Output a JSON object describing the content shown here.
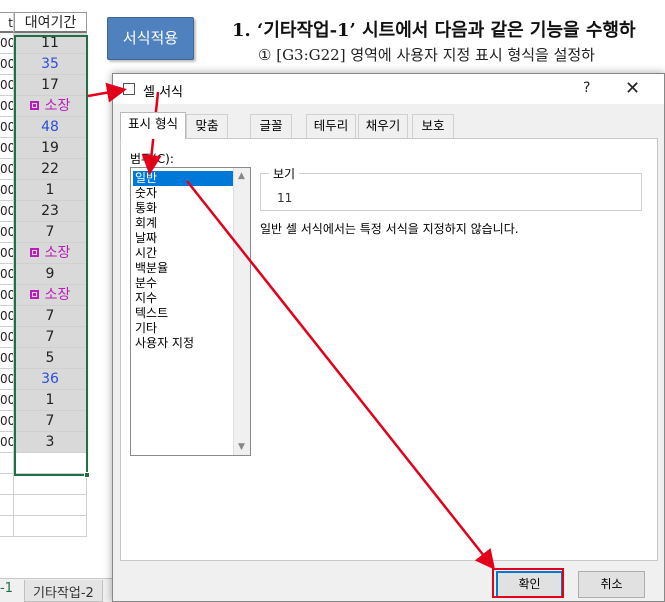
{
  "sheet": {
    "left_col": [
      "t",
      "00",
      "00",
      "00",
      "00",
      "00",
      "00",
      "00",
      "00",
      "00",
      "00",
      "00",
      "00",
      "00",
      "00",
      "00",
      "00",
      "00",
      "00",
      "00",
      "00"
    ],
    "header": "대여기간",
    "rows": [
      {
        "text": "11",
        "style": "plain"
      },
      {
        "text": "35",
        "style": "blue"
      },
      {
        "text": "17",
        "style": "plain"
      },
      {
        "text": "소장",
        "style": "purple"
      },
      {
        "text": "48",
        "style": "blue"
      },
      {
        "text": "19",
        "style": "plain"
      },
      {
        "text": "22",
        "style": "plain"
      },
      {
        "text": "1",
        "style": "plain"
      },
      {
        "text": "23",
        "style": "plain"
      },
      {
        "text": "7",
        "style": "plain"
      },
      {
        "text": "소장",
        "style": "purple"
      },
      {
        "text": "9",
        "style": "plain"
      },
      {
        "text": "소장",
        "style": "purple"
      },
      {
        "text": "7",
        "style": "plain"
      },
      {
        "text": "7",
        "style": "plain"
      },
      {
        "text": "5",
        "style": "plain"
      },
      {
        "text": "36",
        "style": "blue"
      },
      {
        "text": "1",
        "style": "plain"
      },
      {
        "text": "7",
        "style": "plain"
      },
      {
        "text": "3",
        "style": "plain"
      }
    ],
    "tabs": {
      "prev_fragment": "-1",
      "current": "기타작업-2"
    }
  },
  "document": {
    "apply_button": "서식적용",
    "task_title": "1. ‘기타작업-1’ 시트에서 다음과 같은 기능을 수행하",
    "task_line": "① [G3:G22] 영역에 사용자 지정 표시 형식을 설정하"
  },
  "dialog": {
    "title": "셀 서식",
    "help": "?",
    "close": "✕",
    "tabs": [
      "표시 형식",
      "맞춤",
      "글꼴",
      "테두리",
      "채우기",
      "보호"
    ],
    "category_label": "범주(C):",
    "categories": [
      "일반",
      "숫자",
      "통화",
      "회계",
      "날짜",
      "시간",
      "백분율",
      "분수",
      "지수",
      "텍스트",
      "기타",
      "사용자 지정"
    ],
    "selected_category": "일반",
    "preview_label": "보기",
    "preview_value": "11",
    "description": "일반 셀 서식에서는 특정 서식을 지정하지 않습니다.",
    "ok_label": "확인",
    "cancel_label": "취소"
  },
  "colors": {
    "accent_blue": "#4e81bd",
    "selection_green": "#1e7145",
    "annotation_red": "#e3001b",
    "list_selection": "#0078d7",
    "purple_text": "#b81fb8",
    "blue_text": "#2b4fd6"
  }
}
